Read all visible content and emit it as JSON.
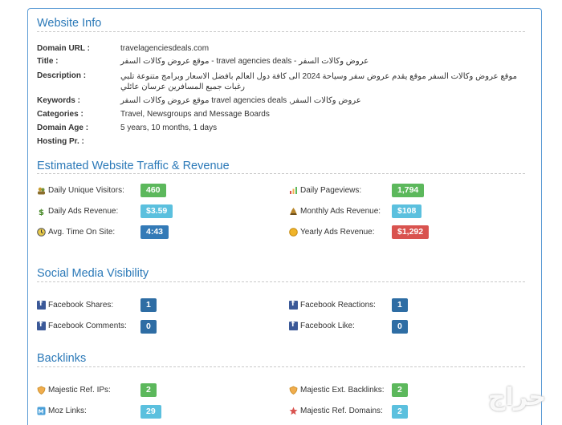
{
  "website_info": {
    "title": "Website Info",
    "rows": [
      {
        "label": "Domain URL :",
        "value": "travelagenciesdeals.com"
      },
      {
        "label": "Title :",
        "value": "عروض وكالات السفر - travel agencies deals - موقع عروض وكالات السفر"
      },
      {
        "label": "Description :",
        "value": "موقع عروض وكالات السفر موقع يقدم عروض سفر وسياحة 2024 الى كافة دول العالم بافضل الاسعار وبرامج متنوعة تلبي رغبات جميع المسافرين عرسان عائلي"
      },
      {
        "label": "Keywords :",
        "value": "عروض وكالات السفر, travel agencies deals موقع عروض وكالات السفر"
      },
      {
        "label": "Categories :",
        "value": "Travel, Newsgroups and Message Boards"
      },
      {
        "label": "Domain Age :",
        "value": "5 years, 10 months, 1 days"
      },
      {
        "label": "Hosting Pr. :",
        "value": ""
      }
    ]
  },
  "traffic": {
    "title": "Estimated Website Traffic & Revenue",
    "daily_unique_visitors": {
      "label": "Daily Unique Visitors:",
      "value": "460",
      "icon": "visitors-icon"
    },
    "daily_pageviews": {
      "label": "Daily Pageviews:",
      "value": "1,794",
      "icon": "pageviews-icon"
    },
    "daily_ads_revenue": {
      "label": "Daily Ads Revenue:",
      "value": "$3.59",
      "icon": "dollar-icon"
    },
    "monthly_ads_revenue": {
      "label": "Monthly Ads Revenue:",
      "value": "$108",
      "icon": "money-bag-icon"
    },
    "avg_time_on_site": {
      "label": "Avg. Time On Site:",
      "value": "4:43",
      "icon": "clock-icon"
    },
    "yearly_ads_revenue": {
      "label": "Yearly Ads Revenue:",
      "value": "$1,292",
      "icon": "coin-icon"
    }
  },
  "social": {
    "title": "Social Media Visibility",
    "facebook_shares": {
      "label": "Facebook Shares:",
      "value": "1"
    },
    "facebook_reactions": {
      "label": "Facebook Reactions:",
      "value": "1"
    },
    "facebook_comments": {
      "label": "Facebook Comments:",
      "value": "0"
    },
    "facebook_like": {
      "label": "Facebook Like:",
      "value": "0"
    }
  },
  "backlinks": {
    "title": "Backlinks",
    "majestic_ref_ips": {
      "label": "Majestic Ref. IPs:",
      "value": "2",
      "icon": "shield-icon"
    },
    "majestic_ext_backlinks": {
      "label": "Majestic Ext. Backlinks:",
      "value": "2",
      "icon": "shield-icon"
    },
    "moz_links": {
      "label": "Moz Links:",
      "value": "29",
      "icon": "moz-icon"
    },
    "majestic_ref_domains": {
      "label": "Majestic Ref. Domains:",
      "value": "2",
      "icon": "star-icon"
    }
  },
  "watermark": "حراج"
}
